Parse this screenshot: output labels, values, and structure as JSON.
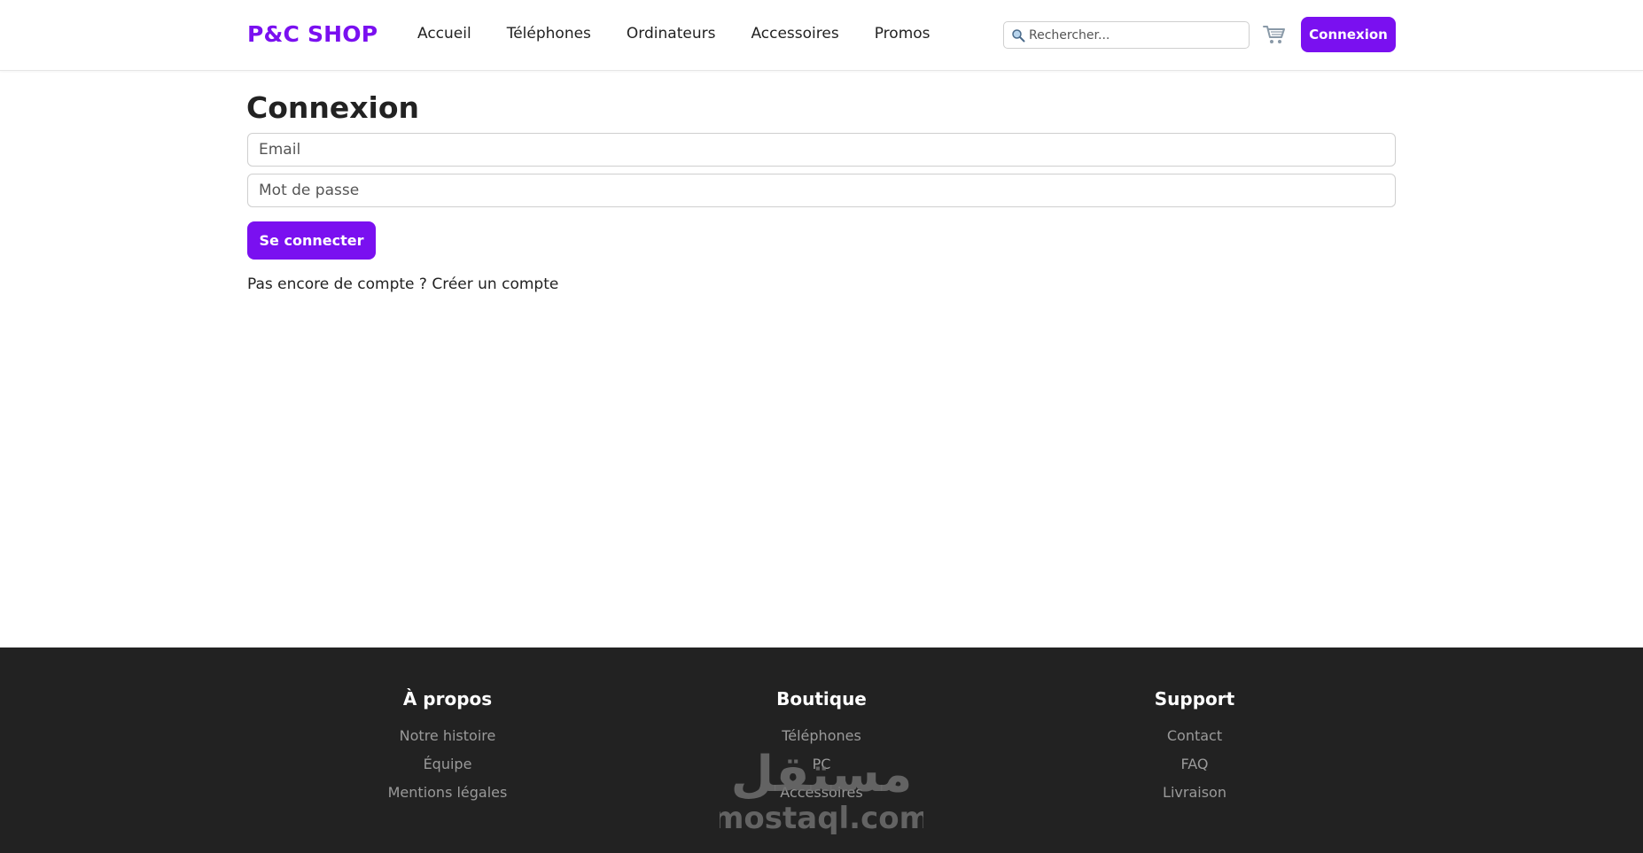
{
  "header": {
    "logo": "P&C SHOP",
    "nav": [
      "Accueil",
      "Téléphones",
      "Ordinateurs",
      "Accessoires",
      "Promos"
    ],
    "search_placeholder": "Rechercher...",
    "search_icon": "search-icon",
    "cart_icon": "cart-icon",
    "login_label": "Connexion"
  },
  "main": {
    "title": "Connexion",
    "email_placeholder": "Email",
    "password_placeholder": "Mot de passe",
    "submit_label": "Se connecter",
    "signup_prompt": "Pas encore de compte ?",
    "signup_link": "Créer un compte"
  },
  "footer": {
    "about": {
      "title": "À propos",
      "links": [
        "Notre histoire",
        "Équipe",
        "Mentions légales"
      ]
    },
    "shop": {
      "title": "Boutique",
      "links": [
        "Téléphones",
        "PC",
        "Accessoires"
      ]
    },
    "support": {
      "title": "Support",
      "links": [
        "Contact",
        "FAQ",
        "Livraison"
      ]
    },
    "watermark": {
      "text_arabic": "مستقل",
      "text_latin": "mostaql.com"
    }
  },
  "colors": {
    "accent": "#7a10f0",
    "footer_bg": "#222222",
    "footer_link": "#9a9a9a"
  }
}
